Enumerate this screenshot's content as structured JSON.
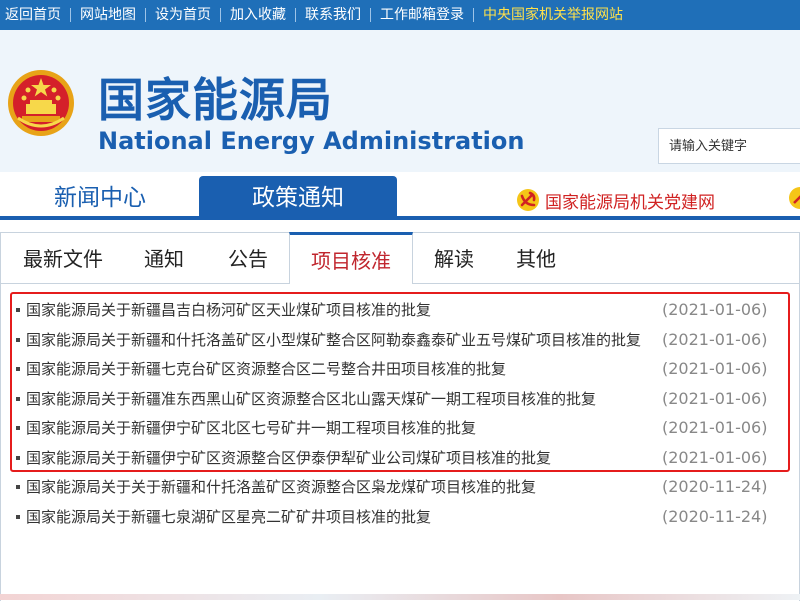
{
  "topbar": {
    "links": [
      "返回首页",
      "网站地图",
      "设为首页",
      "加入收藏",
      "联系我们",
      "工作邮箱登录",
      "中央国家机关举报网站"
    ]
  },
  "header": {
    "title_cn": "国家能源局",
    "title_en": "National Energy Administration",
    "search_placeholder": "请输入关键字"
  },
  "mainnav": {
    "tabs": [
      {
        "label": "新闻中心",
        "active": false
      },
      {
        "label": "政策通知",
        "active": true
      }
    ],
    "party_link": "国家能源局机关党建网"
  },
  "subtabs": [
    {
      "label": "最新文件",
      "active": false
    },
    {
      "label": "通知",
      "active": false
    },
    {
      "label": "公告",
      "active": false
    },
    {
      "label": "项目核准",
      "active": true
    },
    {
      "label": "解读",
      "active": false
    },
    {
      "label": "其他",
      "active": false
    }
  ],
  "documents": [
    {
      "title": "国家能源局关于新疆昌吉白杨河矿区天业煤矿项目核准的批复",
      "date": "(2021-01-06)",
      "highlighted": true
    },
    {
      "title": "国家能源局关于新疆和什托洛盖矿区小型煤矿整合区阿勒泰鑫泰矿业五号煤矿项目核准的批复",
      "date": "(2021-01-06)",
      "highlighted": true
    },
    {
      "title": "国家能源局关于新疆七克台矿区资源整合区二号整合井田项目核准的批复",
      "date": "(2021-01-06)",
      "highlighted": true
    },
    {
      "title": "国家能源局关于新疆准东西黑山矿区资源整合区北山露天煤矿一期工程项目核准的批复",
      "date": "(2021-01-06)",
      "highlighted": true
    },
    {
      "title": "国家能源局关于新疆伊宁矿区北区七号矿井一期工程项目核准的批复",
      "date": "(2021-01-06)",
      "highlighted": true
    },
    {
      "title": "国家能源局关于新疆伊宁矿区资源整合区伊泰伊犁矿业公司煤矿项目核准的批复",
      "date": "(2021-01-06)",
      "highlighted": true
    },
    {
      "title": "国家能源局关于关于新疆和什托洛盖矿区资源整合区枭龙煤矿项目核准的批复",
      "date": "(2020-11-24)",
      "highlighted": false
    },
    {
      "title": "国家能源局关于新疆七泉湖矿区星亮二矿矿井项目核准的批复",
      "date": "(2020-11-24)",
      "highlighted": false
    }
  ],
  "colors": {
    "topbar": "#1f6fb8",
    "brand_blue": "#1a5fb0",
    "active_subtab": "#c0262e",
    "highlight_box": "#e51c1c",
    "party_link": "#d02222",
    "date_gray": "#888888"
  },
  "icons": {
    "emblem": "national-emblem-icon",
    "party": "party-emblem-icon"
  }
}
